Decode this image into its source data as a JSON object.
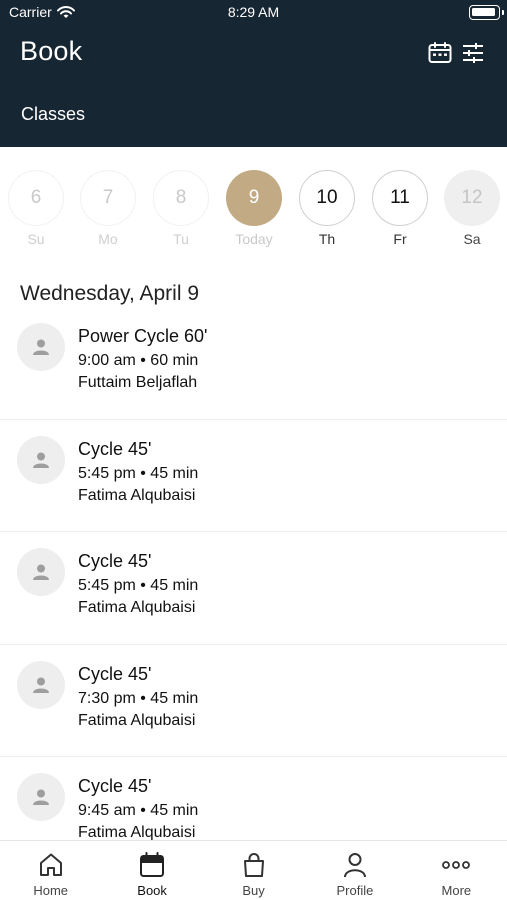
{
  "status_bar": {
    "carrier": "Carrier",
    "time": "8:29 AM"
  },
  "header": {
    "title": "Book",
    "subtitle": "Classes",
    "icons": [
      "calendar-icon",
      "filter-sliders-icon"
    ]
  },
  "days": [
    {
      "num": "6",
      "label": "Su",
      "state": "past"
    },
    {
      "num": "7",
      "label": "Mo",
      "state": "past"
    },
    {
      "num": "8",
      "label": "Tu",
      "state": "past"
    },
    {
      "num": "9",
      "label": "Today",
      "state": "today"
    },
    {
      "num": "10",
      "label": "Th",
      "state": "future"
    },
    {
      "num": "11",
      "label": "Fr",
      "state": "future"
    },
    {
      "num": "12",
      "label": "Sa",
      "state": "dim"
    }
  ],
  "date_heading": "Wednesday, April 9",
  "classes": [
    {
      "name": "Power Cycle 60'",
      "time": "9:00 am • 60 min",
      "instructor": "Futtaim Beljaflah"
    },
    {
      "name": "Cycle 45'",
      "time": "5:45 pm • 45 min",
      "instructor": "Fatima Alqubaisi"
    },
    {
      "name": "Cycle 45'",
      "time": "5:45 pm • 45 min",
      "instructor": "Fatima Alqubaisi"
    },
    {
      "name": "Cycle 45'",
      "time": "7:30 pm • 45 min",
      "instructor": "Fatima Alqubaisi"
    },
    {
      "name": "Cycle 45'",
      "time": "9:45 am • 45 min",
      "instructor": "Fatima Alqubaisi"
    }
  ],
  "tabs": [
    {
      "label": "Home",
      "icon": "home-icon"
    },
    {
      "label": "Book",
      "icon": "calendar-icon",
      "active": true
    },
    {
      "label": "Buy",
      "icon": "shopping-bag-icon"
    },
    {
      "label": "Profile",
      "icon": "person-icon"
    },
    {
      "label": "More",
      "icon": "more-dots-icon"
    }
  ],
  "colors": {
    "header_bg": "#172633",
    "accent": "#c1aa84"
  }
}
